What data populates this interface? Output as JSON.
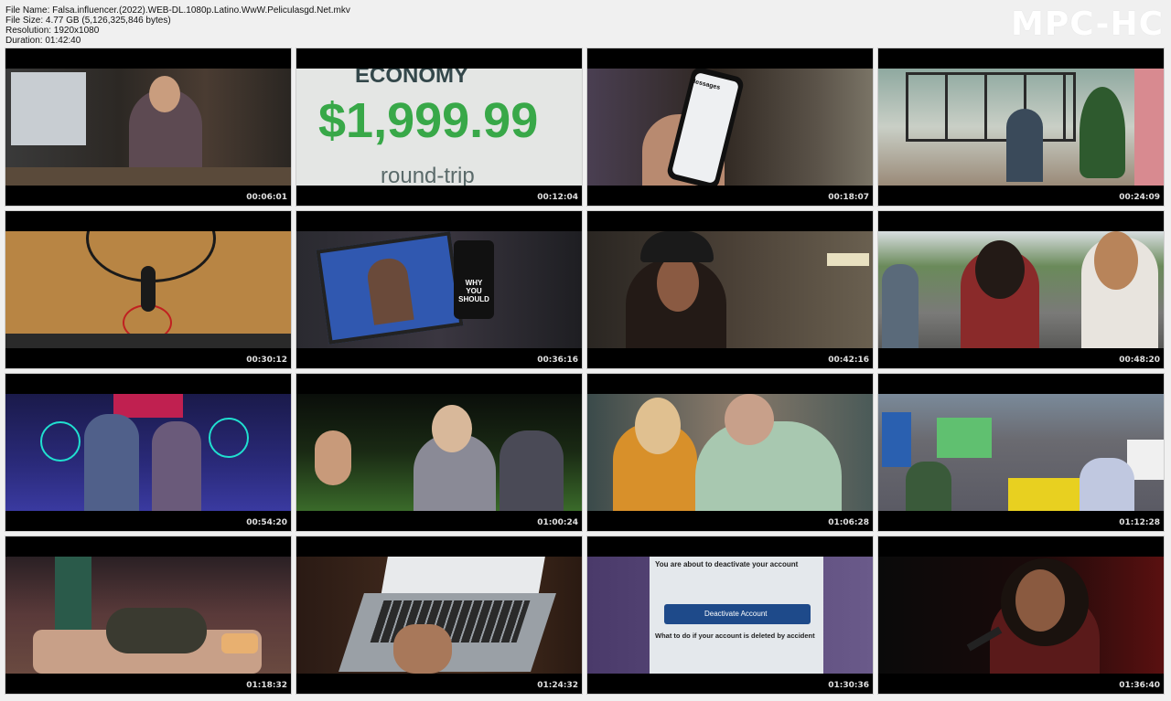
{
  "info": {
    "file_name": "File Name: Falsa.influencer.(2022).WEB-DL.1080p.Latino.WwW.Peliculasgd.Net.mkv",
    "file_size": "File Size: 4.77 GB (5,126,325,846 bytes)",
    "resolution": "Resolution: 1920x1080",
    "duration": "Duration: 01:42:40"
  },
  "logo": "MPC-HC",
  "thumbnails": [
    {
      "time": "00:06:01"
    },
    {
      "time": "00:12:04",
      "text1": "ECONOMY",
      "text2": "$1,999.99",
      "text3": "round-trip"
    },
    {
      "time": "00:18:07",
      "text1": "Messages"
    },
    {
      "time": "00:24:09"
    },
    {
      "time": "00:30:12"
    },
    {
      "time": "00:36:16",
      "text1": "WHY YOU SHOULD"
    },
    {
      "time": "00:42:16"
    },
    {
      "time": "00:48:20"
    },
    {
      "time": "00:54:20"
    },
    {
      "time": "01:00:24"
    },
    {
      "time": "01:06:28"
    },
    {
      "time": "01:12:28"
    },
    {
      "time": "01:18:32"
    },
    {
      "time": "01:24:32"
    },
    {
      "time": "01:30:36",
      "text1": "You are about to deactivate your account",
      "text2": "Deactivate Account",
      "text3": "What to do if your account is deleted by accident"
    },
    {
      "time": "01:36:40"
    }
  ]
}
